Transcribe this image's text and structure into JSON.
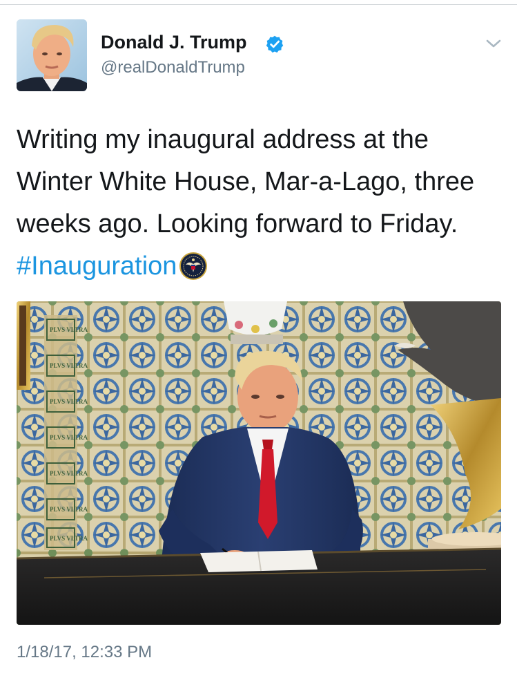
{
  "tweet": {
    "author": {
      "name": "Donald J. Trump",
      "handle": "@realDonaldTrump",
      "verified": true,
      "avatar": "profile-photo"
    },
    "text": {
      "line1": "Writing my inaugural address at the",
      "line2": "Winter White House, Mar-a-Lago, three",
      "line3": "weeks ago. Looking forward to Friday.",
      "hashtag": "#Inauguration",
      "hashflag_icon": "presidential-seal-icon"
    },
    "media": {
      "type": "photo",
      "inscription": "PLVS VLTRA"
    },
    "timestamp": "1/18/17, 12:33 PM"
  },
  "icons": {
    "menu": "chevron-down-icon",
    "verified": "verified-badge-icon"
  },
  "colors": {
    "link": "#1b95e0",
    "verified": "#1da1f2",
    "text": "#14171a",
    "secondary": "#657786"
  }
}
